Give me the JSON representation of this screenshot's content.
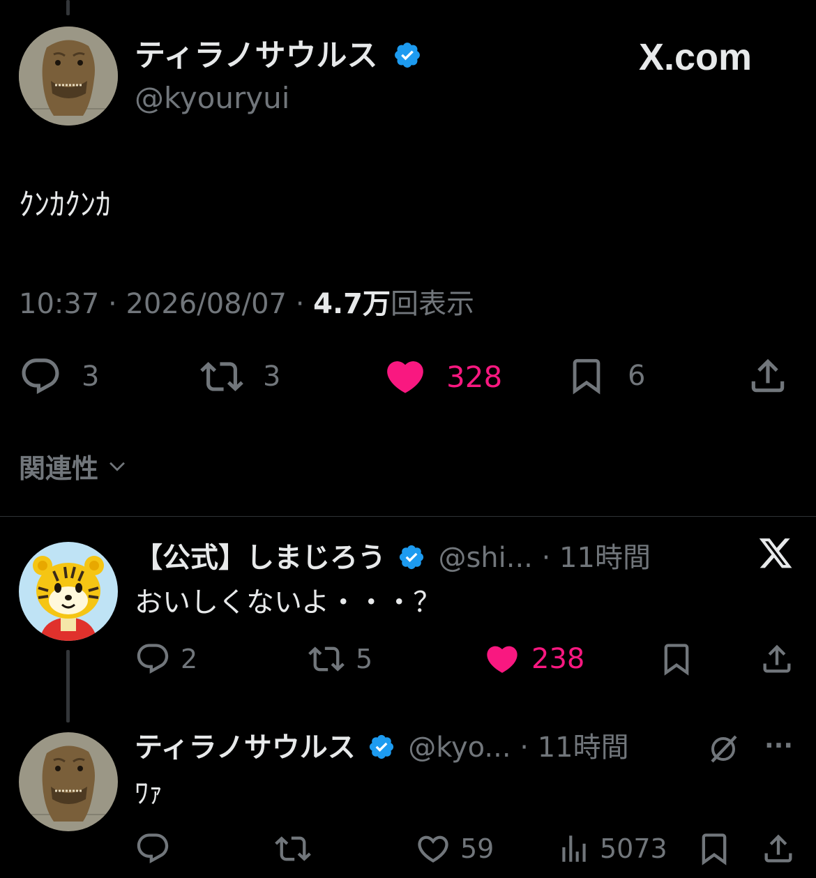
{
  "main_tweet": {
    "author_name": "ティラノサウルス",
    "handle": "@kyouryui",
    "brand": "X.com",
    "text": "ｸﾝｶｸﾝｶ",
    "time": "10:37",
    "sep1": "·",
    "date": "2026/08/07",
    "sep2": "·",
    "views_count": "4.7万",
    "views_label": "回表示",
    "actions": {
      "replies": "3",
      "retweets": "3",
      "likes": "328",
      "bookmarks": "6"
    }
  },
  "sort": {
    "label": "関連性"
  },
  "reply1": {
    "author_name": "【公式】しまじろう",
    "handle": "@shi...",
    "dot": "·",
    "time": "11時間",
    "text": "おいしくないよ・・・？",
    "actions": {
      "replies": "2",
      "retweets": "5",
      "likes": "238"
    }
  },
  "reply2": {
    "author_name": "ティラノサウルス",
    "handle": "@kyo...",
    "dot": "·",
    "time": "11時間",
    "more": "···",
    "text": "ﾜｧ",
    "actions": {
      "likes": "59",
      "views": "5073"
    }
  },
  "colors": {
    "background": "#000000",
    "text": "#e7e9ea",
    "muted": "#71767b",
    "like_pink": "#f91880",
    "verified_blue": "#1d9bf0"
  }
}
